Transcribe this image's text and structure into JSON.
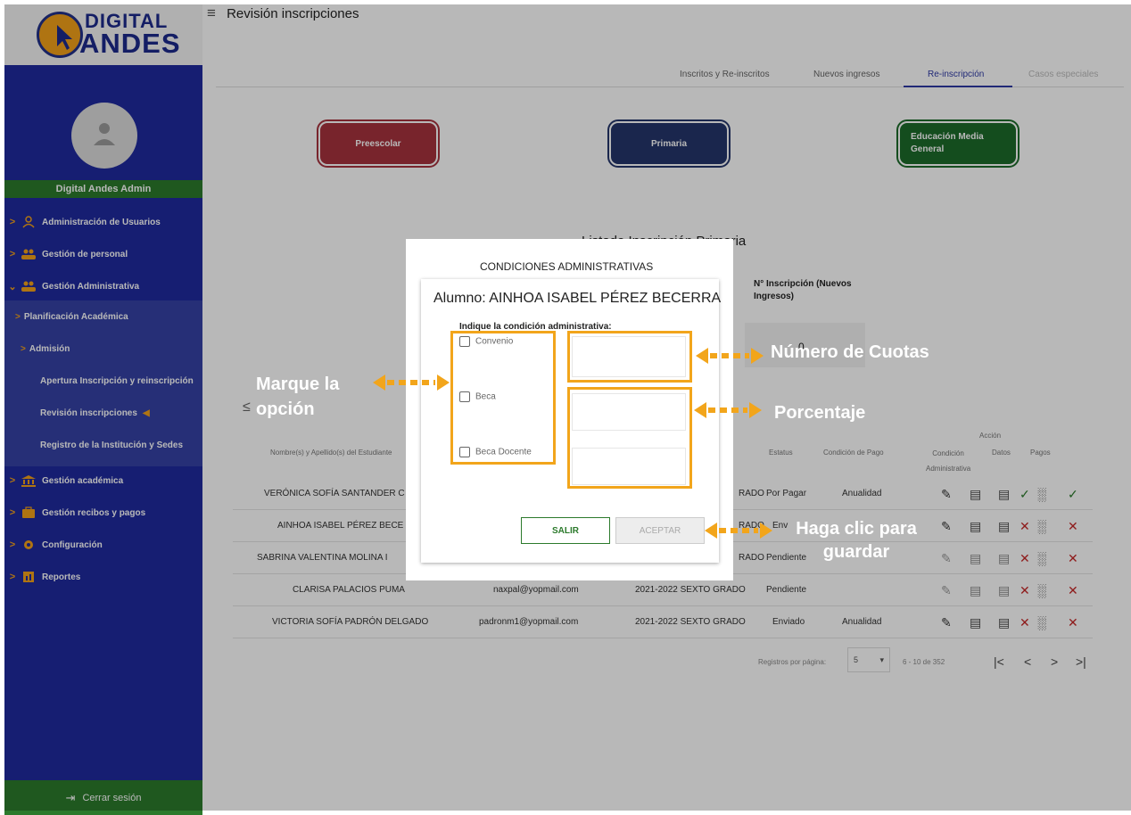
{
  "sidebar": {
    "logo_top": "DIGITAL",
    "logo_bottom": "ANDES",
    "user_name": "Digital Andes Admin",
    "items": [
      {
        "label": "Administración de Usuarios",
        "icon": "user-icon"
      },
      {
        "label": "Gestión de personal",
        "icon": "people-icon"
      },
      {
        "label": "Gestión Administrativa",
        "icon": "people-icon"
      },
      {
        "label": "Gestión académica",
        "icon": "institution-icon"
      },
      {
        "label": "Gestión recibos y pagos",
        "icon": "briefcase-icon"
      },
      {
        "label": "Configuración",
        "icon": "gear-icon"
      },
      {
        "label": "Reportes",
        "icon": "report-icon"
      }
    ],
    "sub_items": {
      "planificacion": "Planificación Académica",
      "admision": "Admisión",
      "apertura": "Apertura Inscripción y reinscripción",
      "revision": "Revisión inscripciones",
      "registro": "Registro de la Institución y Sedes"
    },
    "logout": "Cerrar sesión"
  },
  "header": {
    "title": "Revisión inscripciones"
  },
  "tabs": [
    "Inscritos y Re-inscritos",
    "Nuevos ingresos",
    "Re-inscripción",
    "Casos especiales"
  ],
  "level_cards": {
    "preescolar": "Preescolar",
    "primaria": "Primaria",
    "media": "Educación Media General"
  },
  "list_title": "Listado Inscripción Primaria",
  "inscription_label": "N° Inscripción (Nuevos Ingresos)",
  "inscription_value": "0",
  "table": {
    "headers": {
      "nombre": "Nombre(s) y Apellido(s) del Estudiante",
      "estatus": "Estatus",
      "condicion_pago": "Condición de Pago",
      "condicion_admin": "Condición Administrativa",
      "accion": "Acción",
      "datos": "Datos",
      "pagos": "Pagos"
    },
    "rows": [
      {
        "nombre": "VERÓNICA SOFÍA SANTANDER C",
        "correo": "",
        "grado": "RADO",
        "estatus": "Por Pagar",
        "pago": "Anualidad",
        "ok": true
      },
      {
        "nombre": "AINHOA ISABEL PÉREZ BECE",
        "correo": "",
        "grado": "RADO",
        "estatus": "Env",
        "pago": "Anualidad",
        "ok": false
      },
      {
        "nombre": "SABRINA VALENTINA MOLINA I",
        "correo": "",
        "grado": "RADO",
        "estatus": "Pendiente",
        "pago": "",
        "ok": false
      },
      {
        "nombre": "CLARISA PALACIOS PUMA",
        "correo": "naxpal@yopmail.com",
        "grado": "2021-2022  SEXTO GRADO",
        "estatus": "Pendiente",
        "pago": "",
        "ok": false
      },
      {
        "nombre": "VICTORIA SOFÍA PADRÓN DELGADO",
        "correo": "padronm1@yopmail.com",
        "grado": "2021-2022  SEXTO GRADO",
        "estatus": "Enviado",
        "pago": "Anualidad",
        "ok": false
      }
    ]
  },
  "pagination": {
    "label": "Registros por página:",
    "per_page": "5",
    "range": "6 - 10 de 352"
  },
  "modal": {
    "title": "CONDICIONES ADMINISTRATIVAS",
    "student": "Alumno: AINHOA ISABEL PÉREZ BECERRA",
    "instruction": "Indique la condición administrativa:",
    "options": [
      "Convenio",
      "Beca",
      "Beca Docente"
    ],
    "exit": "SALIR",
    "accept": "ACEPTAR"
  },
  "annotations": {
    "select": "Marque la opción",
    "cuotas": "Número de Cuotas",
    "porcentaje": "Porcentaje",
    "guardar": "Haga clic para guardar"
  },
  "colors": {
    "sidebar": "#1f2a9f",
    "accent_green": "#2c7a2c",
    "accent_orange": "#f2a51b",
    "preescolar": "#a7323e",
    "primaria": "#24356b",
    "media": "#1c6b2a"
  }
}
